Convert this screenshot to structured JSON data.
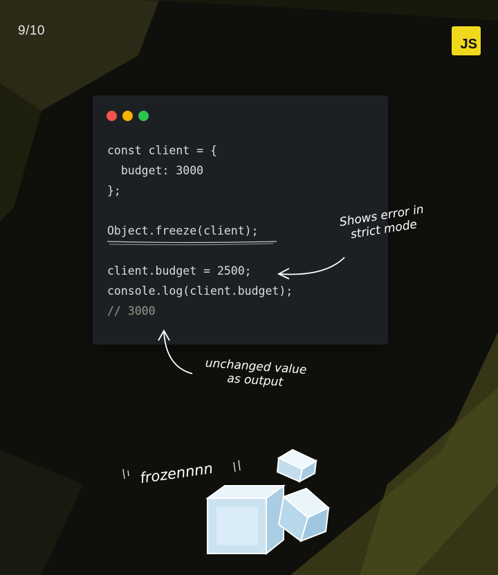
{
  "page": {
    "indicator": "9/10"
  },
  "badge": {
    "label": "JS",
    "color": "#f0d91c"
  },
  "window": {
    "dot_colors": [
      "#f2544b",
      "#f5b400",
      "#2ec44e"
    ]
  },
  "code": {
    "lines": [
      "const client = {",
      "  budget: 3000",
      "};",
      "",
      "Object.freeze(client);",
      "",
      "client.budget = 2500;",
      "console.log(client.budget);",
      "// 3000"
    ]
  },
  "annotations": {
    "strict_mode": [
      "Shows error in",
      "strict mode"
    ],
    "output": [
      "unchanged value",
      "as output"
    ],
    "frozen": "frozennnn"
  },
  "colors": {
    "background": "#0f0f0c",
    "accent_shape": "#3a3a1a",
    "card": "#1d2023",
    "comment": "#8f9a8a"
  }
}
